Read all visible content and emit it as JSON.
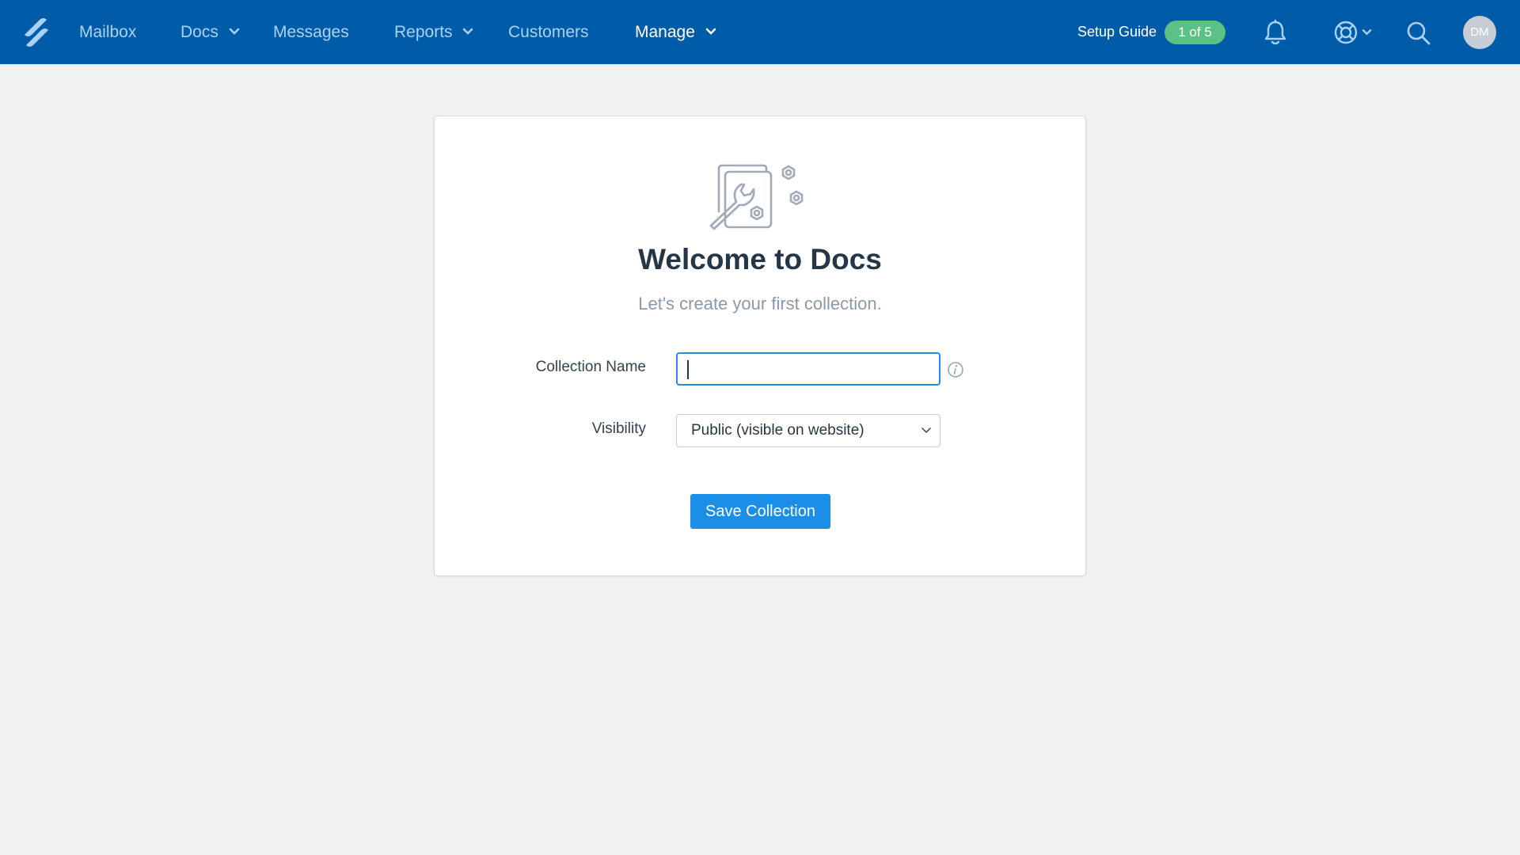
{
  "nav": {
    "logo": "helpscout-logo-icon",
    "items": [
      {
        "label": "Mailbox",
        "has_dropdown": false,
        "active": false
      },
      {
        "label": "Docs",
        "has_dropdown": true,
        "active": false
      },
      {
        "label": "Messages",
        "has_dropdown": false,
        "active": false
      },
      {
        "label": "Reports",
        "has_dropdown": true,
        "active": false
      },
      {
        "label": "Customers",
        "has_dropdown": false,
        "active": false
      },
      {
        "label": "Manage",
        "has_dropdown": true,
        "active": true
      }
    ],
    "setup_guide": {
      "label": "Setup Guide",
      "badge": "1 of 5"
    },
    "icons": [
      "bell-icon",
      "help-lifebuoy-icon",
      "search-icon"
    ],
    "avatar_initials": "DM"
  },
  "colors": {
    "nav_bg": "#005ca8",
    "accent": "#1b8ee8",
    "badge": "#5cc185",
    "page_bg": "#f1f2f4"
  },
  "welcome": {
    "icon": "wrench-gears-icon",
    "title": "Welcome to Docs",
    "subtitle": "Let's create your first collection."
  },
  "form": {
    "collection_name": {
      "label": "Collection Name",
      "value": "",
      "placeholder": ""
    },
    "visibility": {
      "label": "Visibility",
      "selected": "Public (visible on website)"
    },
    "save_label": "Save Collection"
  }
}
